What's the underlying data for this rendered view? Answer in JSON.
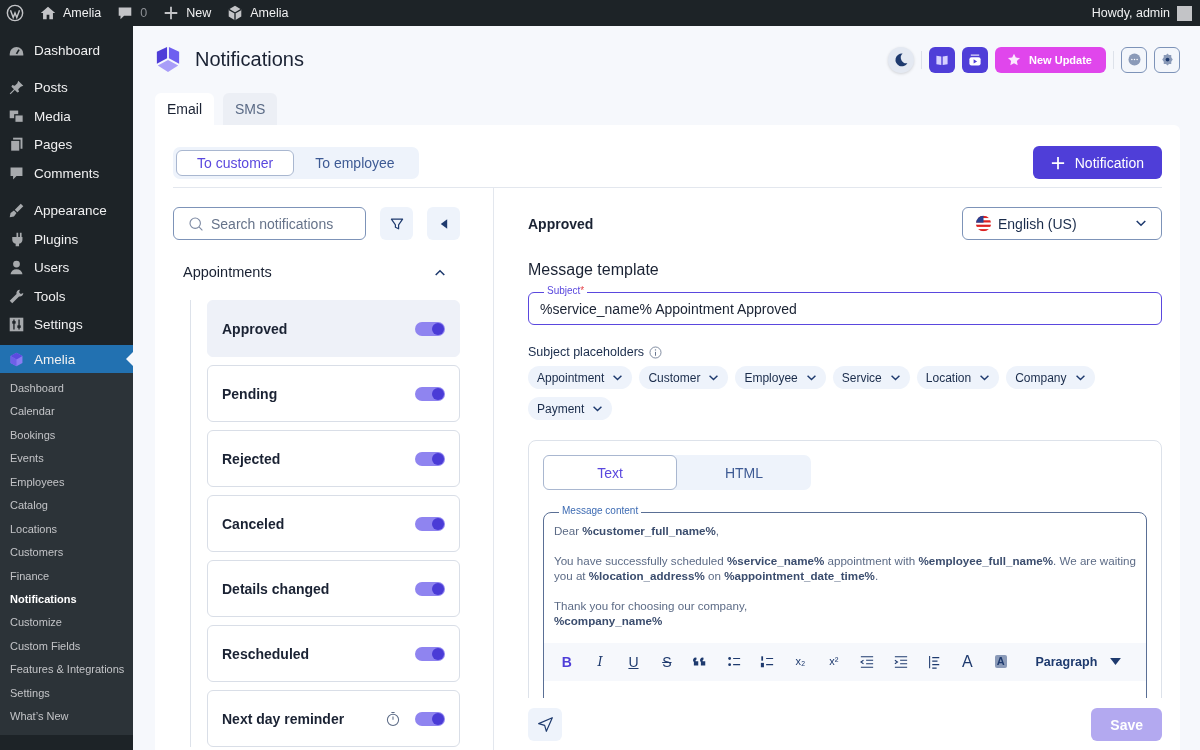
{
  "admin_bar": {
    "items": [
      {
        "kind": "wordpress"
      },
      {
        "kind": "home",
        "label": "Amelia"
      },
      {
        "kind": "comments",
        "label": "0"
      },
      {
        "kind": "new",
        "label": "New"
      },
      {
        "kind": "amelia",
        "label": "Amelia"
      }
    ],
    "greeting": "Howdy, admin"
  },
  "sidebar": {
    "groups": [
      {
        "items": [
          {
            "kind": "dashboard",
            "label": "Dashboard",
            "selected": false
          }
        ]
      },
      {
        "items": [
          {
            "kind": "posts",
            "label": "Posts",
            "selected": false
          },
          {
            "kind": "media",
            "label": "Media",
            "selected": false
          },
          {
            "kind": "pages",
            "label": "Pages",
            "selected": false
          },
          {
            "kind": "comments",
            "label": "Comments",
            "selected": false
          }
        ]
      },
      {
        "items": [
          {
            "kind": "appearance",
            "label": "Appearance",
            "selected": false
          },
          {
            "kind": "plugins",
            "label": "Plugins",
            "selected": false
          },
          {
            "kind": "users",
            "label": "Users",
            "selected": false
          },
          {
            "kind": "tools",
            "label": "Tools",
            "selected": false
          },
          {
            "kind": "settings",
            "label": "Settings",
            "selected": false
          }
        ]
      },
      {
        "items": [
          {
            "kind": "amelia",
            "label": "Amelia",
            "selected": true,
            "children": [
              {
                "label": "Dashboard",
                "selected": false
              },
              {
                "label": "Calendar",
                "selected": false
              },
              {
                "label": "Bookings",
                "selected": false
              },
              {
                "label": "Events",
                "selected": false
              },
              {
                "label": "Employees",
                "selected": false
              },
              {
                "label": "Catalog",
                "selected": false
              },
              {
                "label": "Locations",
                "selected": false
              },
              {
                "label": "Customers",
                "selected": false
              },
              {
                "label": "Finance",
                "selected": false
              },
              {
                "label": "Notifications",
                "selected": true
              },
              {
                "label": "Customize",
                "selected": false
              },
              {
                "label": "Custom Fields",
                "selected": false
              },
              {
                "label": "Features & Integrations",
                "selected": false
              },
              {
                "label": "Settings",
                "selected": false
              },
              {
                "label": "What’s New",
                "selected": false
              }
            ]
          }
        ]
      }
    ]
  },
  "header": {
    "title": "Notifications",
    "actions": [
      {
        "kind": "dark-mode"
      },
      {
        "kind": "guide"
      },
      {
        "kind": "video"
      },
      {
        "kind": "update",
        "label": "New Update"
      },
      {
        "kind": "chat"
      },
      {
        "kind": "settings"
      }
    ]
  },
  "tabs": [
    {
      "label": "Email",
      "selected": true
    },
    {
      "label": "SMS",
      "selected": false
    }
  ],
  "recipient_tabs": [
    {
      "label": "To customer",
      "selected": true
    },
    {
      "label": "To employee",
      "selected": false
    }
  ],
  "add_button": "Notification",
  "search": {
    "placeholder": "Search notifications"
  },
  "notification_groups": [
    {
      "title": "Appointments",
      "expanded": true,
      "items": [
        {
          "label": "Approved",
          "selected": true,
          "enabled": true,
          "timer": false
        },
        {
          "label": "Pending",
          "selected": false,
          "enabled": true,
          "timer": false
        },
        {
          "label": "Rejected",
          "selected": false,
          "enabled": true,
          "timer": false
        },
        {
          "label": "Canceled",
          "selected": false,
          "enabled": true,
          "timer": false
        },
        {
          "label": "Details changed",
          "selected": false,
          "enabled": true,
          "timer": false
        },
        {
          "label": "Rescheduled",
          "selected": false,
          "enabled": true,
          "timer": false
        },
        {
          "label": "Next day reminder",
          "selected": false,
          "enabled": true,
          "timer": true
        }
      ]
    }
  ],
  "detail": {
    "title": "Approved",
    "language": "English (US)",
    "section": "Message template",
    "subject": {
      "label": "Subject",
      "required_mark": "*",
      "value": "%service_name% Appointment Approved"
    },
    "placeholders_label": "Subject placeholders",
    "placeholders": [
      "Appointment",
      "Customer",
      "Employee",
      "Service",
      "Location",
      "Company",
      "Payment"
    ],
    "editor": {
      "modes": [
        {
          "label": "Text",
          "selected": true
        },
        {
          "label": "HTML",
          "selected": false
        }
      ],
      "content_label": "Message content",
      "paragraphs": [
        {
          "text": "Dear **%customer_full_name%**,"
        },
        {
          "text": "You have successfully scheduled **%service_name%** appointment with **%employee_full_name%**. We are waiting you at **%location_address%** on **%appointment_date_time%**."
        },
        {
          "text": "Thank you for choosing our company,",
          "signature": "%company_name%"
        }
      ],
      "toolbar": [
        {
          "kind": "bold",
          "glyph": "B"
        },
        {
          "kind": "italic",
          "glyph": "I"
        },
        {
          "kind": "underline",
          "glyph": "U"
        },
        {
          "kind": "strike",
          "glyph": "S"
        },
        {
          "kind": "quote"
        },
        {
          "kind": "bullets"
        },
        {
          "kind": "numbers"
        },
        {
          "kind": "subscript",
          "glyph": "x₂"
        },
        {
          "kind": "superscript",
          "glyph": "x²"
        },
        {
          "kind": "outdent"
        },
        {
          "kind": "indent"
        },
        {
          "kind": "align"
        },
        {
          "kind": "text-color",
          "glyph": "A"
        },
        {
          "kind": "highlight",
          "glyph": "A"
        }
      ],
      "block_format": "Paragraph"
    }
  },
  "footer": {
    "save": {
      "label": "Save",
      "disabled": true
    }
  }
}
